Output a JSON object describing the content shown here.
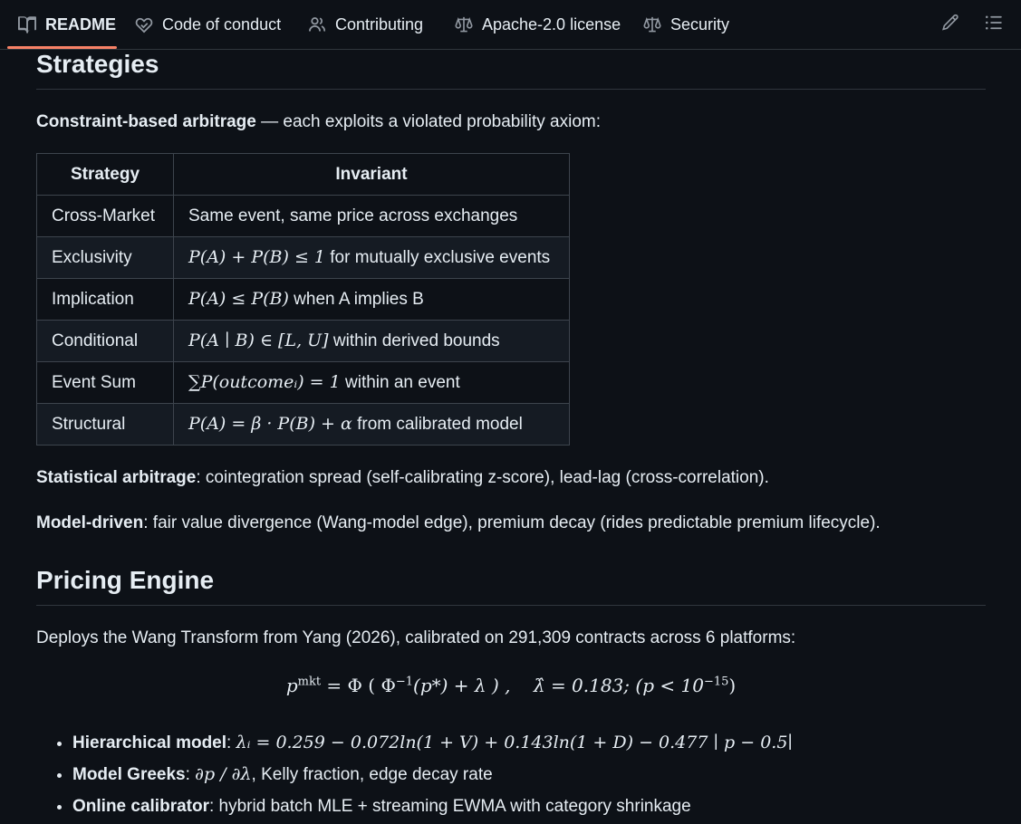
{
  "tabs": [
    {
      "label": "README",
      "icon": "book-icon"
    },
    {
      "label": "Code of conduct",
      "icon": "heart-hand-icon"
    },
    {
      "label": "Contributing",
      "icon": "people-icon"
    },
    {
      "label": "Apache-2.0 license",
      "icon": "scale-icon"
    },
    {
      "label": "Security",
      "icon": "scale-icon"
    }
  ],
  "toolbar": {
    "edit_icon": "pencil-icon",
    "outline_icon": "list-icon"
  },
  "sections": {
    "strategies_title": "Strategies",
    "intro_bold": "Constraint-based arbitrage",
    "intro_rest": " — each exploits a violated probability axiom:",
    "table": {
      "headers": [
        "Strategy",
        "Invariant"
      ],
      "rows": [
        {
          "strategy": "Cross-Market",
          "invariant_math": "",
          "invariant_text": "Same event, same price across exchanges"
        },
        {
          "strategy": "Exclusivity",
          "invariant_math": "P(A) + P(B) ≤ 1",
          "invariant_text": " for mutually exclusive events"
        },
        {
          "strategy": "Implication",
          "invariant_math": "P(A) ≤ P(B)",
          "invariant_text": " when A implies B"
        },
        {
          "strategy": "Conditional",
          "invariant_math": "P(A ∣ B) ∈ [L, U]",
          "invariant_text": " within derived bounds"
        },
        {
          "strategy": "Event Sum",
          "invariant_math": "∑P(outcomeᵢ) = 1",
          "invariant_text": " within an event"
        },
        {
          "strategy": "Structural",
          "invariant_math": "P(A) = β · P(B) + α",
          "invariant_text": " from calibrated model"
        }
      ]
    },
    "stat_bold": "Statistical arbitrage",
    "stat_rest": ": cointegration spread (self-calibrating z-score), lead-lag (cross-correlation).",
    "model_bold": "Model-driven",
    "model_rest": ": fair value divergence (Wang-model edge), premium decay (rides predictable premium lifecycle).",
    "pricing_title": "Pricing Engine",
    "pricing_intro": "Deploys the Wang Transform from Yang (2026), calibrated on 291,309 contracts across 6 platforms:",
    "formula_left": "p",
    "formula_sup": "mkt",
    "formula_mid": " = Φ ( Φ",
    "formula_inv": "−1",
    "formula_right": "(p*) + λ ) ,",
    "formula_lambda": "λ̂ = 0.183; (p < 10",
    "formula_exp": "−15",
    "formula_close": ")",
    "bullets": [
      {
        "bold": "Hierarchical model",
        "sep": ": ",
        "math": "λᵢ = 0.259 − 0.072ln(1 + V) + 0.143ln(1 + D) − 0.477 ∣ p − 0.5∣",
        "text": ""
      },
      {
        "bold": "Model Greeks",
        "sep": ": ",
        "math": "∂p / ∂λ",
        "text": ", Kelly fraction, edge decay rate"
      },
      {
        "bold": "Online calibrator",
        "sep": ": ",
        "math": "",
        "text": "hybrid batch MLE + streaming EWMA with category shrinkage"
      }
    ]
  }
}
